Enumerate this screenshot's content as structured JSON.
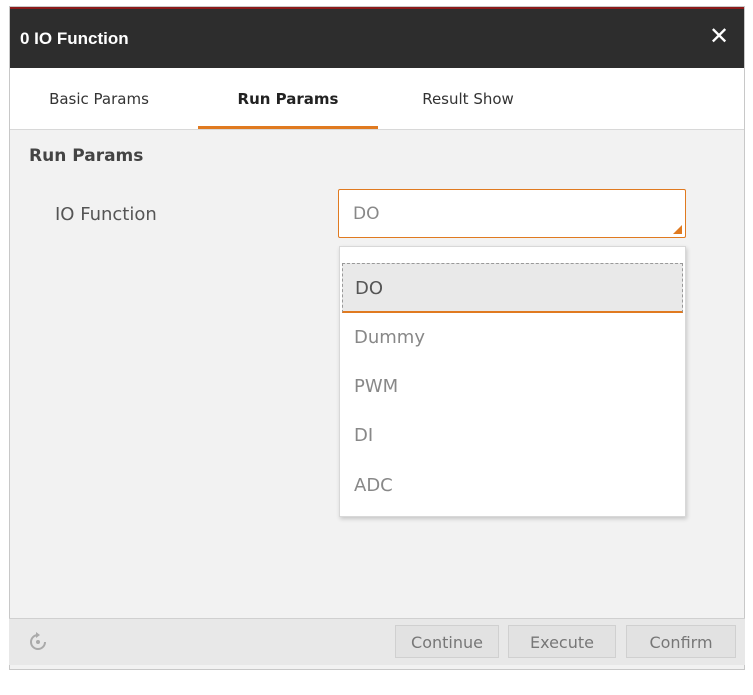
{
  "dialog": {
    "title": "0 IO Function",
    "close_icon": "✕"
  },
  "tabs": [
    {
      "label": "Basic Params"
    },
    {
      "label": "Run Params",
      "active": true
    },
    {
      "label": "Result Show"
    }
  ],
  "main": {
    "section_title": "Run Params",
    "io_function": {
      "label": "IO Function",
      "value": "DO",
      "options": [
        "DO",
        "Dummy",
        "PWM",
        "DI",
        "ADC"
      ]
    }
  },
  "footer": {
    "refresh_icon": "refresh-icon",
    "buttons": [
      {
        "label": "Continue"
      },
      {
        "label": "Execute"
      },
      {
        "label": "Confirm"
      }
    ]
  },
  "colors": {
    "accent": "#e07a20",
    "titlebar": "#2d2d2d"
  }
}
